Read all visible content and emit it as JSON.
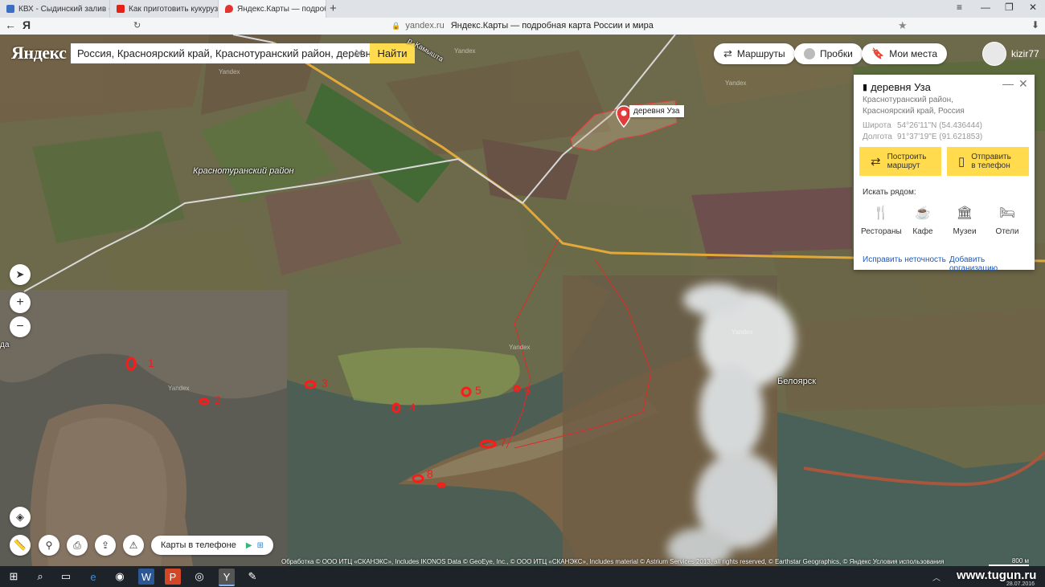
{
  "browser": {
    "tabs": [
      {
        "title": "КВХ - Сыдинский залив - С",
        "color": "#3a6fc4"
      },
      {
        "title": "Как приготовить кукурузу д",
        "color": "#e62117"
      },
      {
        "title": "Яндекс.Карты — подробн",
        "color": "#e3342f"
      }
    ],
    "new_tab": "+",
    "window_controls": [
      "≡",
      "—",
      "❐",
      "✕"
    ],
    "address": {
      "domain": "yandex.ru",
      "title": "Яндекс.Карты — подробная карта России и мира"
    }
  },
  "map": {
    "logo": "Яндекс",
    "search": {
      "value": "Россия, Красноярский край, Краснотуранский район, деревня Уза",
      "button": "Найти"
    },
    "top_buttons": {
      "routes": "Маршруты",
      "traffic": "Пробки",
      "my_places": "Мои места"
    },
    "user": "kizir77",
    "labels": {
      "district": "Краснотуранский район",
      "town": "Белоярск",
      "river": "р. Камышта",
      "place_pin": "деревня Уза",
      "left_edge": "да"
    },
    "watermark": "Yandex",
    "markers": [
      "1",
      "2",
      "3",
      "4",
      "5",
      "6",
      "7",
      "8"
    ],
    "phone_pill": "Карты в телефоне",
    "copyright": "Обработка © ООО ИТЦ «СКАНЭКС», Includes IKONOS Data © GeoEye, Inc., © ООО ИТЦ «СКАНЭКС», Includes material © Astrium Services 2013, all rights reserved, © Earthstar Geographics, © Яндекс Условия использования",
    "scale": "800 м"
  },
  "card": {
    "title": "деревня Уза",
    "address_line1": "Краснотуранский район,",
    "address_line2": "Красноярский край, Россия",
    "lat_label": "Широта",
    "lat_value": "54°26'11\"N (54.436444)",
    "lon_label": "Долгота",
    "lon_value": "91°37'19\"E (91.621853)",
    "route_btn_1": "Построить",
    "route_btn_2": "маршрут",
    "phone_btn_1": "Отправить",
    "phone_btn_2": "в телефон",
    "nearby": "Искать рядом:",
    "categories": [
      "Рестораны",
      "Кафе",
      "Музеи",
      "Отели"
    ],
    "fix_link": "Исправить неточность",
    "add_link": "Добавить организацию"
  },
  "taskbar": {
    "watermark": "www.tugun.ru",
    "date": "28.07.2016"
  }
}
